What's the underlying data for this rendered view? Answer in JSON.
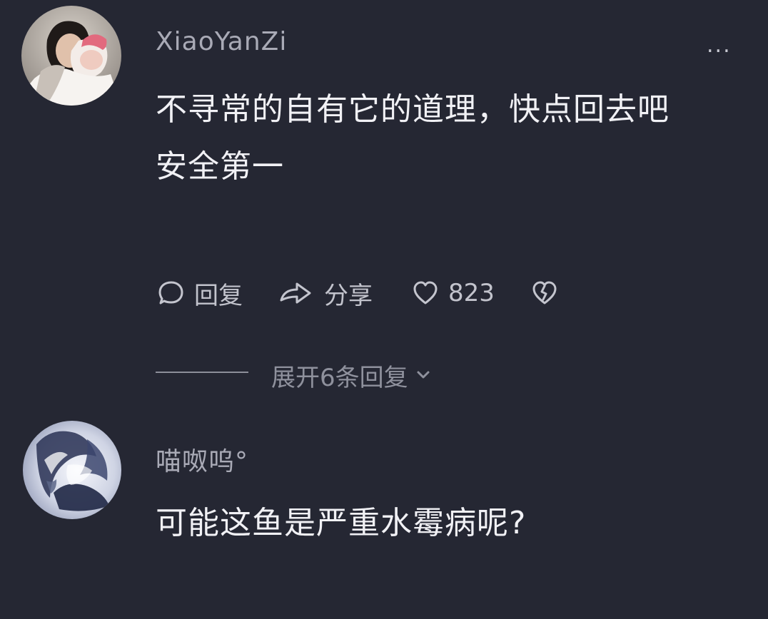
{
  "comments": [
    {
      "username": "XiaoYanZi",
      "text_lines": [
        "不寻常的自有它的道理，快点回去吧",
        "安全第一"
      ],
      "actions": {
        "reply_label": "回复",
        "share_label": "分享",
        "like_count": "823"
      },
      "more_label": "...",
      "expand_label": "展开6条回复"
    },
    {
      "username": "喵呶呜°",
      "text": "可能这鱼是严重水霉病呢?"
    }
  ],
  "icons": {
    "more": "more-icon",
    "reply": "comment-bubble-icon",
    "share": "share-arrow-icon",
    "like": "heart-icon",
    "dislike": "broken-heart-icon",
    "expand": "chevron-down-icon"
  },
  "colors": {
    "background": "#252733",
    "body_text": "#f1f1f5",
    "username": "#a9aab6",
    "muted": "#8f919d"
  }
}
